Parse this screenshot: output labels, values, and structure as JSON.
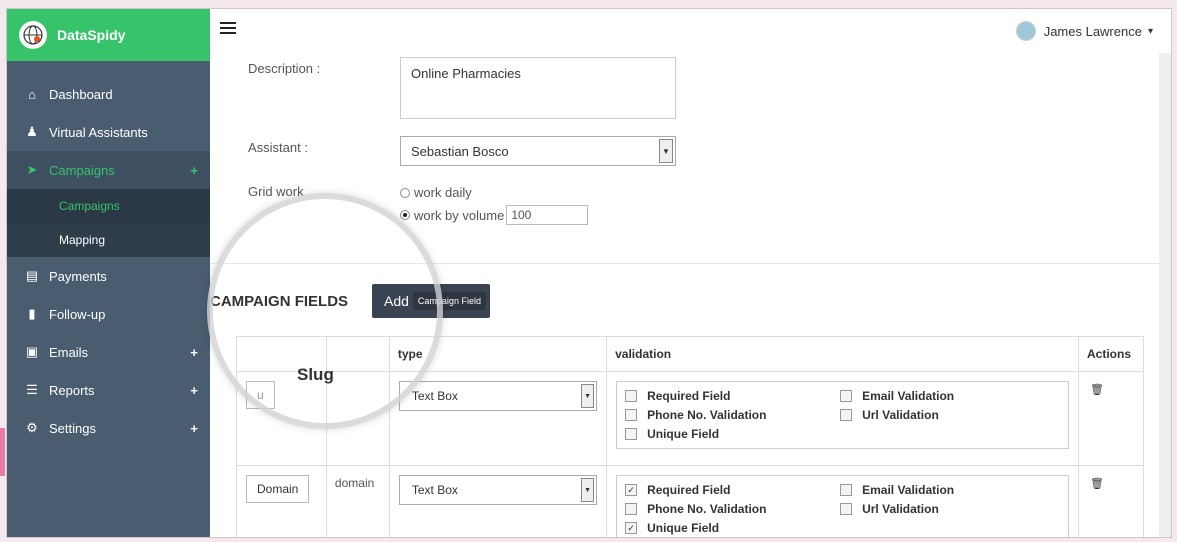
{
  "brand": {
    "name": "DataSpidy"
  },
  "nav": {
    "dashboard": "Dashboard",
    "virtual_assistants": "Virtual Assistants",
    "campaigns": "Campaigns",
    "campaigns_sub": "Campaigns",
    "mapping": "Mapping",
    "payments": "Payments",
    "followup": "Follow-up",
    "emails": "Emails",
    "reports": "Reports",
    "settings": "Settings",
    "plus": "+"
  },
  "user": {
    "name": "James Lawrence",
    "caret": "▾"
  },
  "form": {
    "description_label": "Description :",
    "description_value": "Online Pharmacies",
    "assistant_label": "Assistant :",
    "assistant_value": "Sebastian Bosco",
    "grid_label": "Grid work",
    "work_daily": "work daily",
    "work_by_volume": "work by volume",
    "volume_value": "100"
  },
  "section": {
    "title": "CAMPAIGN FIELDS",
    "add_label": "Add",
    "tooltip": "Campaign Field"
  },
  "table": {
    "headers": {
      "slug": "Slug",
      "type": "type",
      "validation": "validation",
      "actions": "Actions"
    },
    "rows": [
      {
        "name": "",
        "slug": "",
        "type": "Text Box",
        "checks": {
          "required": false,
          "email": false,
          "phone": false,
          "url": false,
          "unique": false
        }
      },
      {
        "name": "Domain",
        "slug": "domain",
        "type": "Text Box",
        "checks": {
          "required": true,
          "email": false,
          "phone": false,
          "url": false,
          "unique": true
        }
      }
    ],
    "labels": {
      "required": "Required Field",
      "email": "Email Validation",
      "phone": "Phone No. Validation",
      "url": "Url Validation",
      "unique": "Unique Field"
    },
    "row0_name_partial": "u",
    "slug_underline": "-"
  },
  "colors": {
    "brand_green": "#37c36a",
    "sidebar": "#4a5c6f",
    "sidebar_dark": "#2f3d4b"
  },
  "icons": [
    "globe-spider-icon",
    "home-icon",
    "users-icon",
    "megaphone-icon",
    "card-icon",
    "bookmark-icon",
    "inbox-icon",
    "reports-icon",
    "gears-icon",
    "hamburger-icon",
    "trash-icon"
  ]
}
